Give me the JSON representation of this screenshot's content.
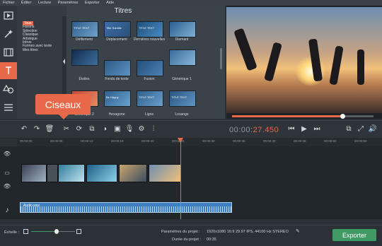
{
  "menu": [
    "Fichier",
    "Éditer",
    "Lecture",
    "Paramètres",
    "Exporter",
    "Aide"
  ],
  "titles_panel": {
    "heading": "Titres",
    "categories": [
      "Tous",
      "Favoris",
      "Sélection",
      "Classique",
      "Artistique",
      "Intros",
      "Formes avec texte",
      "Mes titres"
    ],
    "selected_category": "Tous",
    "tiles": [
      {
        "label": "Défilement",
        "thumb_text": "TITLE TEXT"
      },
      {
        "label": "Déplacement",
        "thumb_text": "Title Subtitle"
      },
      {
        "label": "Dernières nouvelles",
        "thumb_text": "TITLE TEXT"
      },
      {
        "label": "Diamant",
        "thumb_text": ""
      },
      {
        "label": "Étoiles",
        "thumb_text": ""
      },
      {
        "label": "Fondu de texte",
        "thumb_text": ""
      },
      {
        "label": "Fusion",
        "thumb_text": ""
      },
      {
        "label": "Générique 1",
        "thumb_text": ""
      },
      {
        "label": "Générique 2",
        "thumb_text": ""
      },
      {
        "label": "Hexagone",
        "thumb_text": "Be Happy"
      },
      {
        "label": "Ligne",
        "thumb_text": "TITLE TEXT"
      },
      {
        "label": "Losange",
        "thumb_text": "TITLE TEXT"
      }
    ]
  },
  "tooltip": "Ciseaux",
  "timecode": {
    "dim": "00:00:",
    "hot": "27.450"
  },
  "playback_progress": 0.78,
  "ruler": [
    "00:00:00",
    "00:00:05",
    "00:00:10",
    "00:00:15",
    "00:00:20",
    "00:00:25",
    "00:00:30",
    "00:00:35",
    "00:00:40",
    "00:00:45",
    "00:00:50",
    "00:00:55"
  ],
  "audio": {
    "name": "Audio.wav"
  },
  "bottom": {
    "scale_label": "Échelle :",
    "params_label": "Paramètres du projet :",
    "params_value": "1920x1080 16:9 29.97 IPS, 44100 Hz STEREO",
    "duration_label": "Durée du projet :",
    "duration_value": "00:35",
    "export_label": "Exporter"
  },
  "colors": {
    "accent": "#e8694a",
    "export": "#3f9b63"
  }
}
